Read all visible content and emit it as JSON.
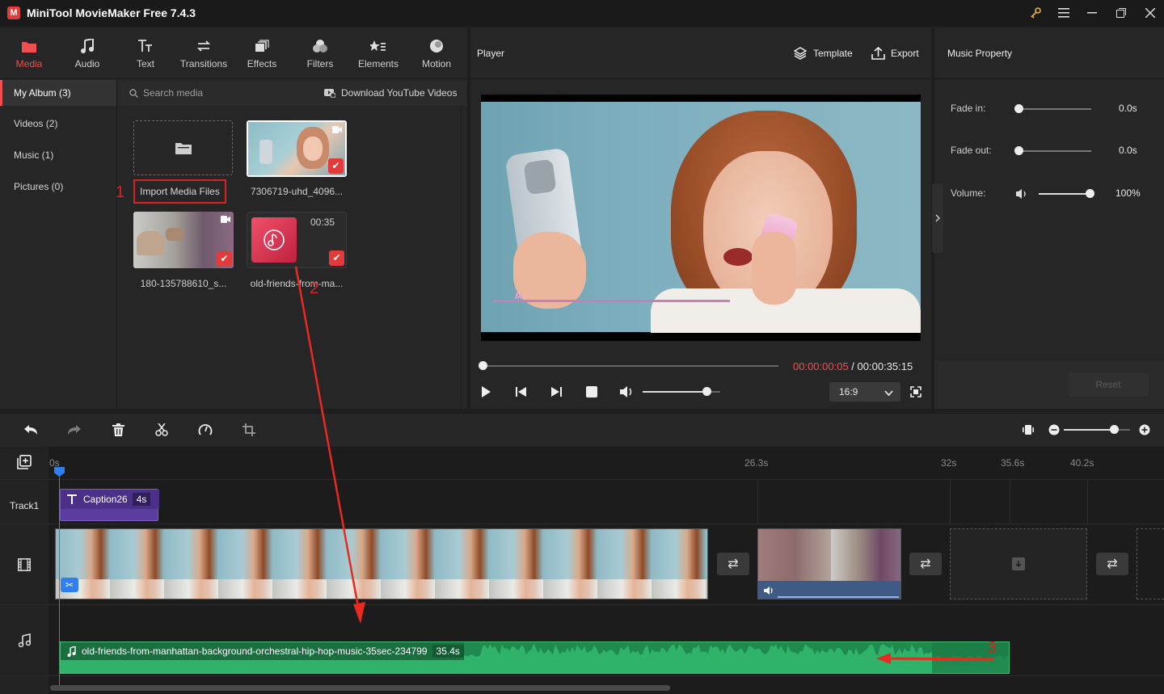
{
  "app": {
    "title": "MiniTool MovieMaker Free 7.4.3"
  },
  "toolbar": {
    "items": [
      {
        "label": "Media",
        "icon": "folder-icon",
        "active": true
      },
      {
        "label": "Audio",
        "icon": "music-note-icon",
        "active": false
      },
      {
        "label": "Text",
        "icon": "text-icon",
        "active": false
      },
      {
        "label": "Transitions",
        "icon": "transition-icon",
        "active": false
      },
      {
        "label": "Effects",
        "icon": "effects-icon",
        "active": false
      },
      {
        "label": "Filters",
        "icon": "filters-icon",
        "active": false
      },
      {
        "label": "Elements",
        "icon": "elements-icon",
        "active": false
      },
      {
        "label": "Motion",
        "icon": "motion-icon",
        "active": false
      }
    ]
  },
  "sidebar": {
    "items": [
      {
        "label": "My Album (3)",
        "selected": true
      },
      {
        "label": "Videos (2)"
      },
      {
        "label": "Music (1)"
      },
      {
        "label": "Pictures (0)"
      }
    ]
  },
  "media": {
    "search_placeholder": "Search media",
    "download_label": "Download YouTube Videos",
    "import_label": "Import Media Files",
    "items": [
      {
        "caption": "7306719-uhd_4096...",
        "type": "video"
      },
      {
        "caption": "180-135788610_s...",
        "type": "video"
      },
      {
        "caption": "old-friends-from-ma...",
        "type": "audio",
        "duration": "00:35"
      }
    ]
  },
  "annotations": {
    "one": "1",
    "two": "2",
    "three": "3"
  },
  "player": {
    "title": "Player",
    "template_label": "Template",
    "export_label": "Export",
    "current_time": "00:00:00:05",
    "separator": " / ",
    "total_time": "00:00:35:15",
    "aspect": "16:9",
    "volume": 0.82,
    "progress": 0.0
  },
  "property": {
    "title": "Music Property",
    "fade_in_label": "Fade in:",
    "fade_in_value": "0.0s",
    "fade_out_label": "Fade out:",
    "fade_out_value": "0.0s",
    "volume_label": "Volume:",
    "volume_value": "100%",
    "reset_label": "Reset"
  },
  "timeline": {
    "ruler": [
      "0s",
      "26.3s",
      "32s",
      "35.6s",
      "40.2s"
    ],
    "track1_label": "Track1",
    "caption_clip": {
      "name": "Caption26",
      "duration": "4s"
    },
    "audio_clip": {
      "name": "old-friends-from-manhattan-background-orchestral-hip-hop-music-35sec-234799",
      "duration": "35.4s"
    },
    "zoom": 0.75
  },
  "colors": {
    "accent": "#ef4f4f",
    "audio_green": "#1f9a55",
    "caption_purple": "#5a3d9e",
    "playhead": "#2f7ff0"
  }
}
